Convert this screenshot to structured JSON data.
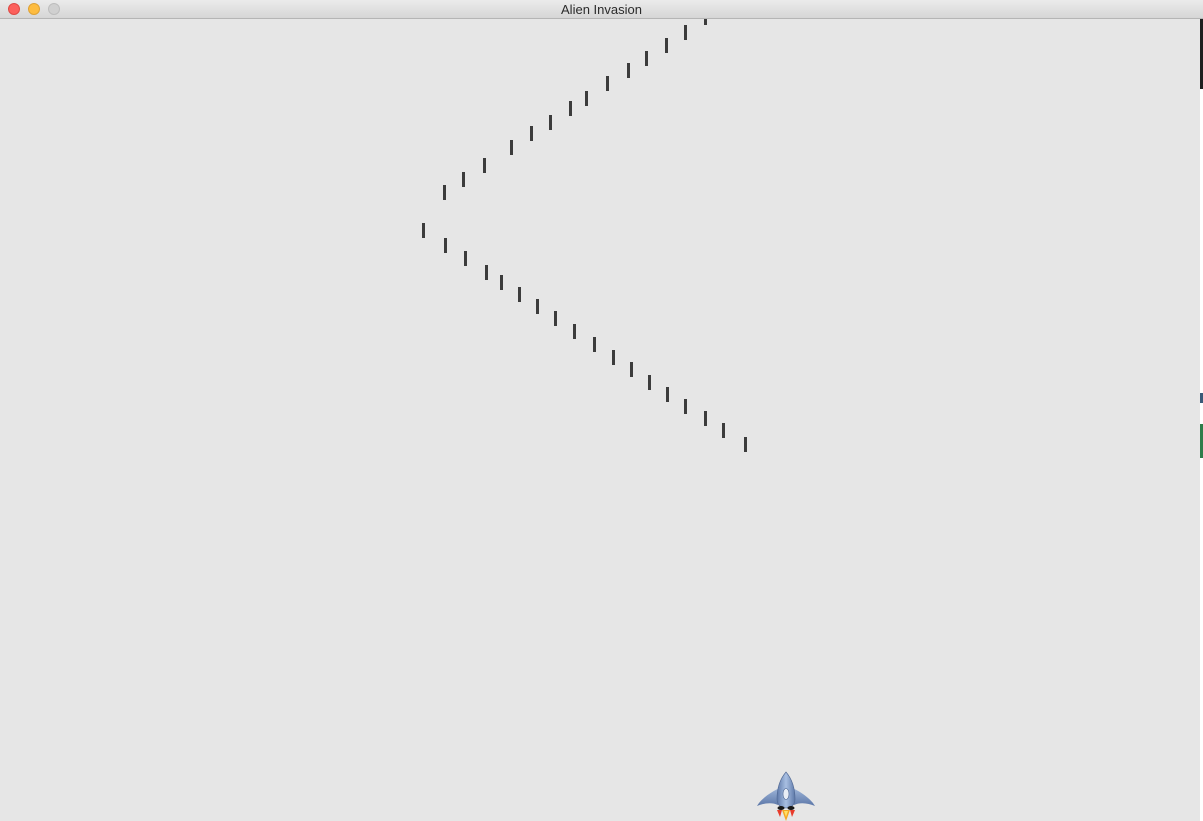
{
  "window": {
    "title": "Alien Invasion"
  },
  "colors": {
    "background": "#e6e6e6",
    "bullet": "#3c3c3c"
  },
  "icons": {
    "ship": "rocket-ship-icon"
  }
}
